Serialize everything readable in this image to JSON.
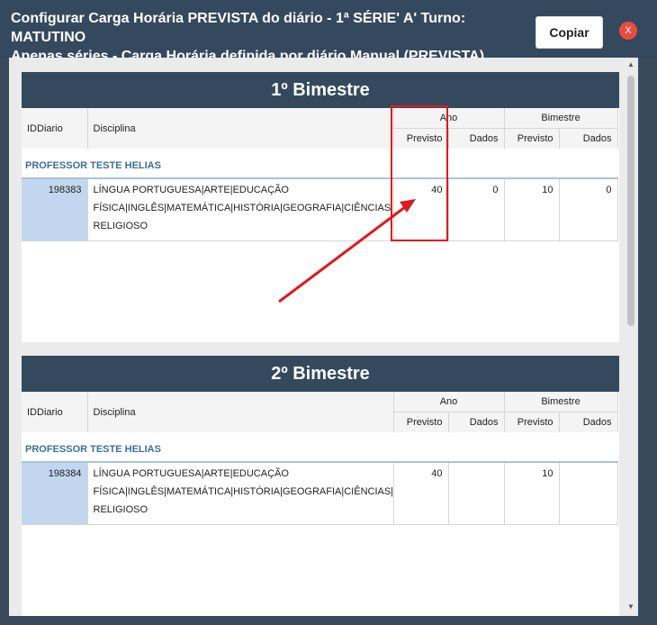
{
  "dialog": {
    "title_line1": "Configurar Carga Horária PREVISTA do diário - 1ª SÉRIE' A' Turno: MATUTINO",
    "title_line2": "Apenas séries - Carga Horária definida por diário Manual (PREVISTA)",
    "copy_label": "Copiar",
    "close_label": "X"
  },
  "columns": {
    "id": "IDDiario",
    "discipline": "Disciplina",
    "group_year": "Ano",
    "group_bimester": "Bimestre",
    "planned": "Previsto",
    "data": "Dados"
  },
  "bimesters": [
    {
      "title": "1º Bimestre",
      "professor": "PROFESSOR TESTE HELIAS",
      "row": {
        "id": "198383",
        "discipline_line1": "LÍNGUA PORTUGUESA|ARTE|EDUCAÇÃO",
        "discipline_line2": "FÍSICA|INGLÊS|MATEMÁTICA|HISTÓRIA|GEOGRAFIA|CIÊNCIAS|ENSINO",
        "discipline_line3": "RELIGIOSO",
        "year_planned": "40",
        "year_data": "0",
        "bim_planned": "10",
        "bim_data": "0"
      }
    },
    {
      "title": "2º Bimestre",
      "professor": "PROFESSOR TESTE HELIAS",
      "row": {
        "id": "198384",
        "discipline_line1": "LÍNGUA PORTUGUESA|ARTE|EDUCAÇÃO",
        "discipline_line2": "FÍSICA|INGLÊS|MATEMÁTICA|HISTÓRIA|GEOGRAFIA|CIÊNCIAS|ENSINO",
        "discipline_line3": "RELIGIOSO",
        "year_planned": "40",
        "year_data": "",
        "bim_planned": "10",
        "bim_data": ""
      }
    }
  ],
  "colors": {
    "header": "#34495e",
    "id_cell": "#c2d7ef",
    "professor_text": "#3d6ea0",
    "annotation": "#e0191d",
    "close": "#e74c3c"
  }
}
